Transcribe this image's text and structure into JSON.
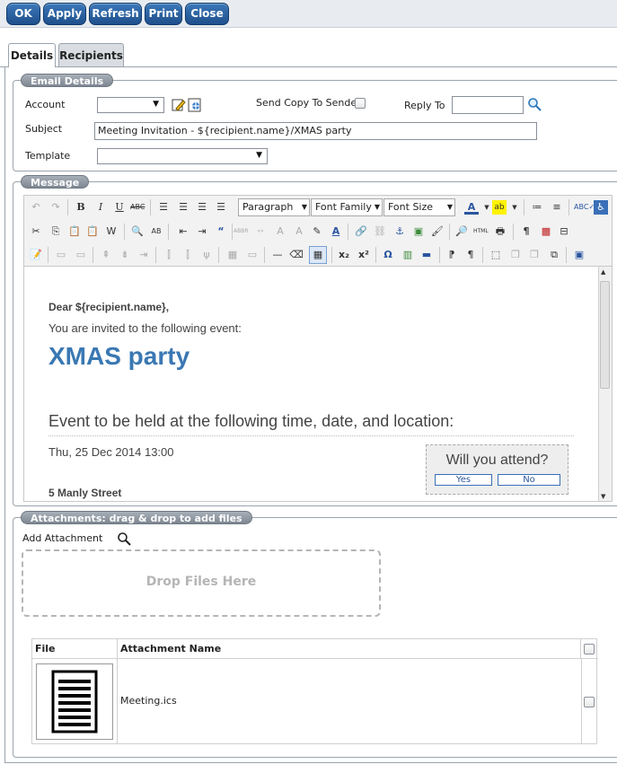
{
  "toolbar": {
    "ok": "OK",
    "apply": "Apply",
    "refresh": "Refresh",
    "print": "Print",
    "close": "Close"
  },
  "tabs": [
    {
      "label": "Details",
      "active": true
    },
    {
      "label": "Recipients",
      "active": false
    }
  ],
  "email_details": {
    "legend": "Email Details",
    "account_label": "Account",
    "account_value": "",
    "send_copy_label": "Send Copy To Sender",
    "send_copy_checked": false,
    "reply_to_label": "Reply To",
    "reply_to_value": "",
    "subject_label": "Subject",
    "subject_value": "Meeting Invitation - ${recipient.name}/XMAS party",
    "template_label": "Template",
    "template_value": ""
  },
  "message": {
    "legend": "Message",
    "format_select": "Paragraph",
    "font_family_select": "Font Family",
    "font_size_select": "Font Size",
    "content": {
      "greeting": "Dear ${recipient.name},",
      "intro": "You are invited to the following event:",
      "event_title": "XMAS party",
      "section_heading": "Event to be held at the following time, date, and location:",
      "datetime": "Thu, 25 Dec 2014 13:00",
      "address": "5 Manly Street",
      "attend_question": "Will you attend?",
      "yes_label": "Yes",
      "no_label": "No"
    },
    "colors": {
      "event_title": "#3a78b3"
    }
  },
  "attachments": {
    "legend": "Attachments: drag & drop to add files",
    "add_label": "Add Attachment",
    "drop_label": "Drop Files Here",
    "columns": {
      "file": "File",
      "name": "Attachment Name"
    },
    "rows": [
      {
        "name": "Meeting.ics",
        "checked": false
      }
    ]
  }
}
